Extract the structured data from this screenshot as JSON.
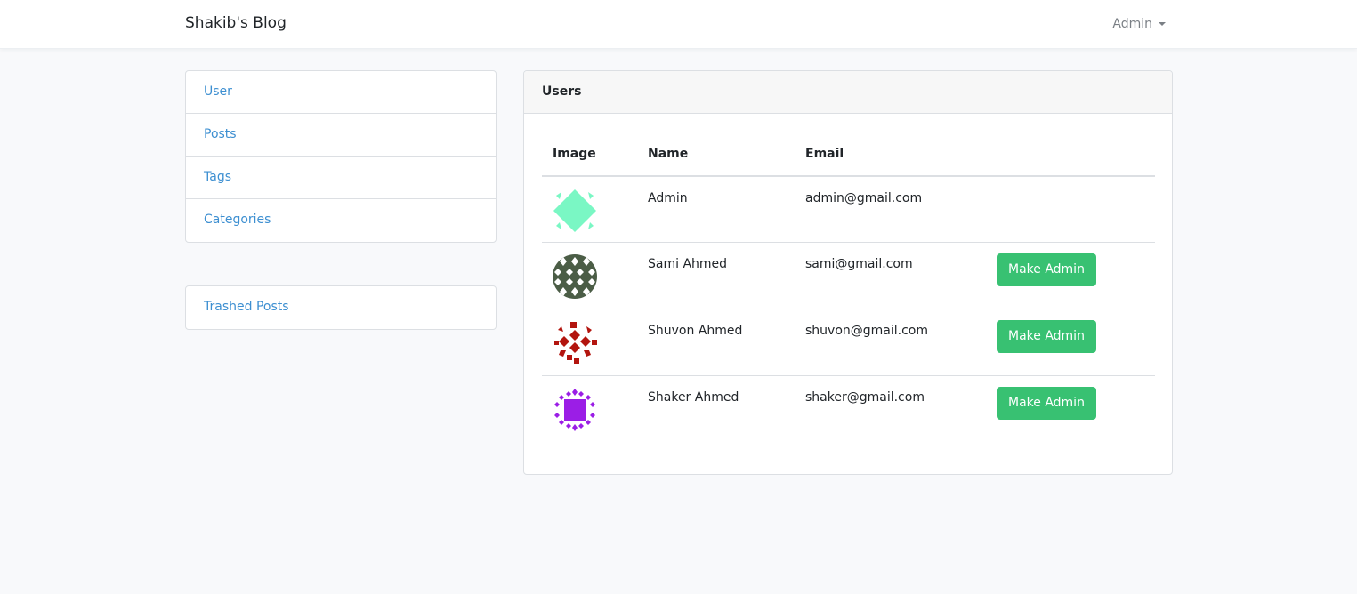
{
  "navbar": {
    "brand": "Shakib's Blog",
    "user_menu_label": "Admin"
  },
  "sidebar": {
    "main_items": [
      {
        "label": "User"
      },
      {
        "label": "Posts"
      },
      {
        "label": "Tags"
      },
      {
        "label": "Categories"
      }
    ],
    "secondary_items": [
      {
        "label": "Trashed Posts"
      }
    ]
  },
  "users_card": {
    "title": "Users",
    "columns": [
      "Image",
      "Name",
      "Email",
      ""
    ],
    "rows": [
      {
        "avatar": "identicon-mint",
        "name": "Admin",
        "email": "admin@gmail.com",
        "action": ""
      },
      {
        "avatar": "identicon-olive",
        "name": "Sami Ahmed",
        "email": "sami@gmail.com",
        "action": "Make Admin"
      },
      {
        "avatar": "identicon-red",
        "name": "Shuvon Ahmed",
        "email": "shuvon@gmail.com",
        "action": "Make Admin"
      },
      {
        "avatar": "identicon-purple",
        "name": "Shaker Ahmed",
        "email": "shaker@gmail.com",
        "action": "Make Admin"
      }
    ]
  },
  "colors": {
    "link": "#3d8fd1",
    "button": "#38c172",
    "avatar_mint": "#7af7c4",
    "avatar_olive": "#4b5d46",
    "avatar_red": "#b3150f",
    "avatar_purple": "#9b1ee6"
  }
}
